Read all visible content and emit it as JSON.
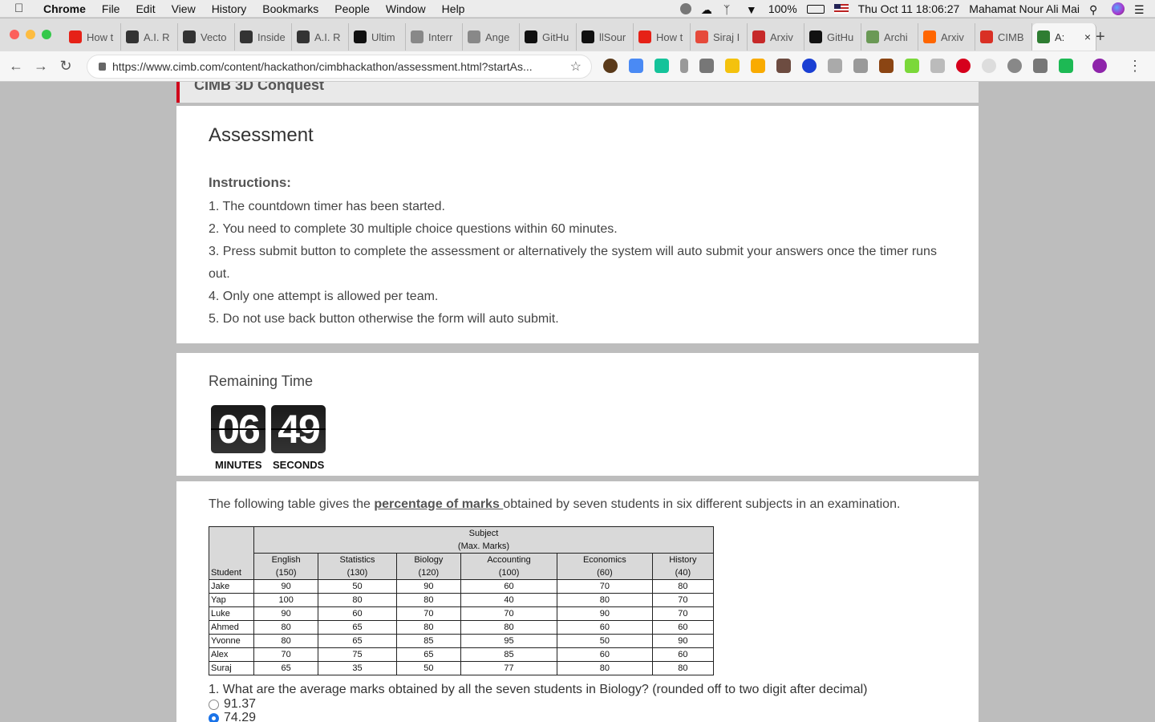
{
  "menubar": {
    "apple": "",
    "items": [
      "Chrome",
      "File",
      "Edit",
      "View",
      "History",
      "Bookmarks",
      "People",
      "Window",
      "Help"
    ],
    "battery": "100%",
    "datetime": "Thu Oct 11  18:06:27",
    "user": "Mahamat Nour Ali Mai"
  },
  "tabs": [
    {
      "label": "How t",
      "icon": "youtube-icon",
      "color": "#e62117"
    },
    {
      "label": "A.I. R",
      "icon": "nyt-icon",
      "color": "#333333"
    },
    {
      "label": "Vecto",
      "icon": "vector-icon",
      "color": "#333333"
    },
    {
      "label": "Inside",
      "icon": "inside-icon",
      "color": "#333333"
    },
    {
      "label": "A.I. R",
      "icon": "nyt-icon",
      "color": "#333333"
    },
    {
      "label": "Ultim",
      "icon": "medium-icon",
      "color": "#111111"
    },
    {
      "label": "Interr",
      "icon": "bowl-icon",
      "color": "#888888"
    },
    {
      "label": "Ange",
      "icon": "peace-icon",
      "color": "#888888"
    },
    {
      "label": "GitHu",
      "icon": "github-icon",
      "color": "#111111"
    },
    {
      "label": "llSour",
      "icon": "github-icon",
      "color": "#111111"
    },
    {
      "label": "How t",
      "icon": "youtube-icon",
      "color": "#e62117"
    },
    {
      "label": "Siraj I",
      "icon": "record-icon",
      "color": "#e64a3b"
    },
    {
      "label": "Arxiv",
      "icon": "as-icon",
      "color": "#c62828"
    },
    {
      "label": "GitHu",
      "icon": "github-icon",
      "color": "#111111"
    },
    {
      "label": "Archi",
      "icon": "archive-icon",
      "color": "#6a9955"
    },
    {
      "label": "Arxiv",
      "icon": "ycombinator-icon",
      "color": "#ff6600"
    },
    {
      "label": "CIMB",
      "icon": "gmail-icon",
      "color": "#d93025"
    },
    {
      "label": "A:",
      "icon": "cimb-icon",
      "color": "#2e7d32",
      "active": true
    }
  ],
  "toolbar": {
    "url": "https://www.cimb.com/content/hackathon/cimbhackathon/assessment.html?startAs..."
  },
  "page": {
    "header": "CIMB 3D Conquest",
    "title": "Assessment",
    "instructions_label": "Instructions:",
    "instructions": [
      "1. The countdown timer has been started.",
      "2. You need to complete 30 multiple choice questions within 60 minutes.",
      "3. Press submit button to complete the assessment or alternatively the system will auto submit your answers once the timer runs out.",
      "4. Only one attempt is allowed per team.",
      "5. Do not use back button otherwise the form will auto submit."
    ],
    "remaining_time_label": "Remaining Time",
    "minutes": "06",
    "seconds": "49",
    "minutes_label": "MINUTES",
    "seconds_label": "SECONDS",
    "intro_prefix": "The following table gives the ",
    "intro_highlight": "percentage of marks ",
    "intro_suffix": "obtained by seven students in six different subjects in an examination.",
    "table": {
      "subject_header": "Subject",
      "max_marks_header": "(Max. Marks)",
      "student_header": "Student",
      "subjects": [
        {
          "name": "English",
          "max": "(150)"
        },
        {
          "name": "Statistics",
          "max": "(130)"
        },
        {
          "name": "Biology",
          "max": "(120)"
        },
        {
          "name": "Accounting",
          "max": "(100)"
        },
        {
          "name": "Economics",
          "max": "(60)"
        },
        {
          "name": "History",
          "max": "(40)"
        }
      ],
      "rows": [
        {
          "student": "Jake",
          "values": [
            "90",
            "50",
            "90",
            "60",
            "70",
            "80"
          ]
        },
        {
          "student": "Yap",
          "values": [
            "100",
            "80",
            "80",
            "40",
            "80",
            "70"
          ]
        },
        {
          "student": "Luke",
          "values": [
            "90",
            "60",
            "70",
            "70",
            "90",
            "70"
          ]
        },
        {
          "student": "Ahmed",
          "values": [
            "80",
            "65",
            "80",
            "80",
            "60",
            "60"
          ]
        },
        {
          "student": "Yvonne",
          "values": [
            "80",
            "65",
            "85",
            "95",
            "50",
            "90"
          ]
        },
        {
          "student": "Alex",
          "values": [
            "70",
            "75",
            "65",
            "85",
            "60",
            "60"
          ]
        },
        {
          "student": "Suraj",
          "values": [
            "65",
            "35",
            "50",
            "77",
            "80",
            "80"
          ]
        }
      ]
    },
    "question": "1. What are the average marks obtained by all the seven students in Biology? (rounded off to two digit after decimal)",
    "options": [
      {
        "label": "91.37",
        "selected": false
      },
      {
        "label": "74.29",
        "selected": true
      }
    ]
  }
}
